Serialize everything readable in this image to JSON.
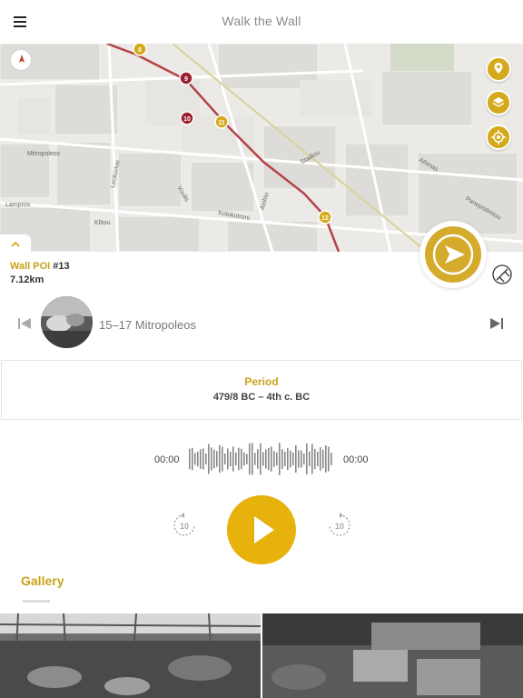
{
  "header": {
    "title": "Walk the Wall",
    "menu_icon": "hamburger-menu-icon"
  },
  "map": {
    "street_labels": [
      "Mitropoleos",
      "Leokoriou",
      "Kolokotroni",
      "Lampros",
      "Klitou",
      "Stadiou",
      "Panepistimiou",
      "Voulis",
      "Aiolou",
      "Athinas"
    ],
    "markers": [
      {
        "label": "8",
        "color": "#d4a91b"
      },
      {
        "label": "9",
        "color": "#9a2230"
      },
      {
        "label": "10",
        "color": "#9a2230"
      },
      {
        "label": "11",
        "color": "#d4a91b"
      },
      {
        "label": "12",
        "color": "#d4a91b"
      }
    ],
    "route_color": "#b3444a",
    "accent": "#d4a91b"
  },
  "poi": {
    "label": "Wall POI",
    "number": "#13",
    "distance": "7.12km",
    "name": "15–17 Mitropoleos"
  },
  "period": {
    "label": "Period",
    "value": "479/8 BC – 4th c. BC"
  },
  "audio": {
    "current_time": "00:00",
    "total_time": "00:00",
    "rewind_seconds": "10",
    "forward_seconds": "10",
    "play_color": "#e6b20b"
  },
  "gallery": {
    "title": "Gallery"
  }
}
